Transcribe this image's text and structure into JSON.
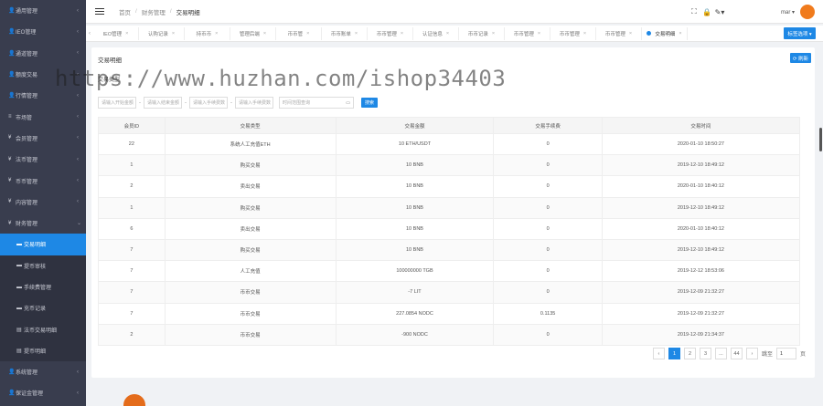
{
  "sidebar": {
    "items": [
      {
        "icon": "👤",
        "label": "通用管理",
        "arrow": "‹"
      },
      {
        "icon": "👤",
        "label": "IEO管理",
        "arrow": "‹"
      },
      {
        "icon": "👤",
        "label": "通道管理",
        "arrow": "‹"
      },
      {
        "icon": "👤",
        "label": "额度交易",
        "arrow": "‹"
      },
      {
        "icon": "👤",
        "label": "行情管理",
        "arrow": "‹"
      },
      {
        "icon": "≡",
        "label": "市场管",
        "arrow": "‹"
      },
      {
        "icon": "¥",
        "label": "会员管理",
        "arrow": "‹"
      },
      {
        "icon": "¥",
        "label": "法币管理",
        "arrow": "‹"
      },
      {
        "icon": "¥",
        "label": "币币管理",
        "arrow": "‹"
      },
      {
        "icon": "¥",
        "label": "内容管理",
        "arrow": "‹"
      },
      {
        "icon": "¥",
        "label": "财务管理",
        "arrow": "⌄"
      }
    ],
    "sub_items": [
      {
        "icon": "▬",
        "label": "交易明细",
        "active": true
      },
      {
        "icon": "▬",
        "label": "提币审核",
        "active": false
      },
      {
        "icon": "▬",
        "label": "手续费管理",
        "active": false
      },
      {
        "icon": "▬",
        "label": "充币记录",
        "active": false
      },
      {
        "icon": "▤",
        "label": "法币交易明细",
        "active": false
      },
      {
        "icon": "▤",
        "label": "提币明细",
        "active": false
      }
    ],
    "bottom_items": [
      {
        "icon": "👤",
        "label": "系统管理",
        "arrow": "‹"
      },
      {
        "icon": "👤",
        "label": "保证金管理",
        "arrow": "‹"
      }
    ]
  },
  "header": {
    "breadcrumb": [
      "首页",
      "财务管理",
      "交易明细"
    ],
    "separator": "/",
    "icons": {
      "fullscreen": "⛶",
      "lock": "🔒",
      "theme": "✎▾"
    },
    "user": "mar ▾"
  },
  "tabs": {
    "prev": "‹",
    "items": [
      "IEO管理",
      "认购记录",
      "持币币",
      "管理后端",
      "币币管",
      "币币账单",
      "币币管理",
      "认证信息",
      "币币记录",
      "币币管理",
      "币币管理",
      "币币管理",
      "交易明细"
    ],
    "close_label": "×",
    "action": "标签选项 ▾"
  },
  "panel": {
    "title": "交易明细",
    "refresh": "⟳ 刷新",
    "filter_label": "交易类型",
    "filters": {
      "start_amount": "请输入开始金额",
      "end_amount": "请输入结束金额",
      "start_fee": "请输入手续费数",
      "end_fee": "请输入手续费数",
      "date": "时间范围查询"
    },
    "search": "搜索"
  },
  "table": {
    "headers": [
      "会员ID",
      "交易类型",
      "交易金额",
      "交易手续费",
      "交易时间"
    ],
    "rows": [
      [
        "22",
        "系统人工充值ETH",
        "10 ETH/USDT",
        "0",
        "2020-01-10 18:50:27"
      ],
      [
        "1",
        "购买交易",
        "10 BNB",
        "0",
        "2019-12-10 18:49:12"
      ],
      [
        "2",
        "卖出交易",
        "10 BNB",
        "0",
        "2020-01-10 18:40:12"
      ],
      [
        "1",
        "购买交易",
        "10 BNB",
        "0",
        "2019-12-10 18:49:12"
      ],
      [
        "6",
        "卖出交易",
        "10 BNB",
        "0",
        "2020-01-10 18:40:12"
      ],
      [
        "7",
        "购买交易",
        "10 BNB",
        "0",
        "2019-12-10 18:49:12"
      ],
      [
        "7",
        "人工充值",
        "100000000 TGB",
        "0",
        "2019-12-12 18:53:06"
      ],
      [
        "7",
        "币币交易",
        "-7 LIT",
        "0",
        "2019-12-09 21:32:27"
      ],
      [
        "7",
        "币币交易",
        "227.0854 NODC",
        "0.1135",
        "2019-12-09 21:32:27"
      ],
      [
        "2",
        "币币交易",
        "-900 NODC",
        "0",
        "2019-12-09 21:34:37"
      ]
    ]
  },
  "pagination": {
    "prev": "‹",
    "pages": [
      "1",
      "2",
      "3",
      "...",
      "44"
    ],
    "next": "›",
    "goto_label": "跳至",
    "goto_value": "1",
    "page_unit": "页"
  },
  "watermark": "https://www.huzhan.com/ishop34403",
  "colors": {
    "sidebar": "#393d4e",
    "accent": "#1e88e5",
    "avatar": "#f07b1d"
  }
}
